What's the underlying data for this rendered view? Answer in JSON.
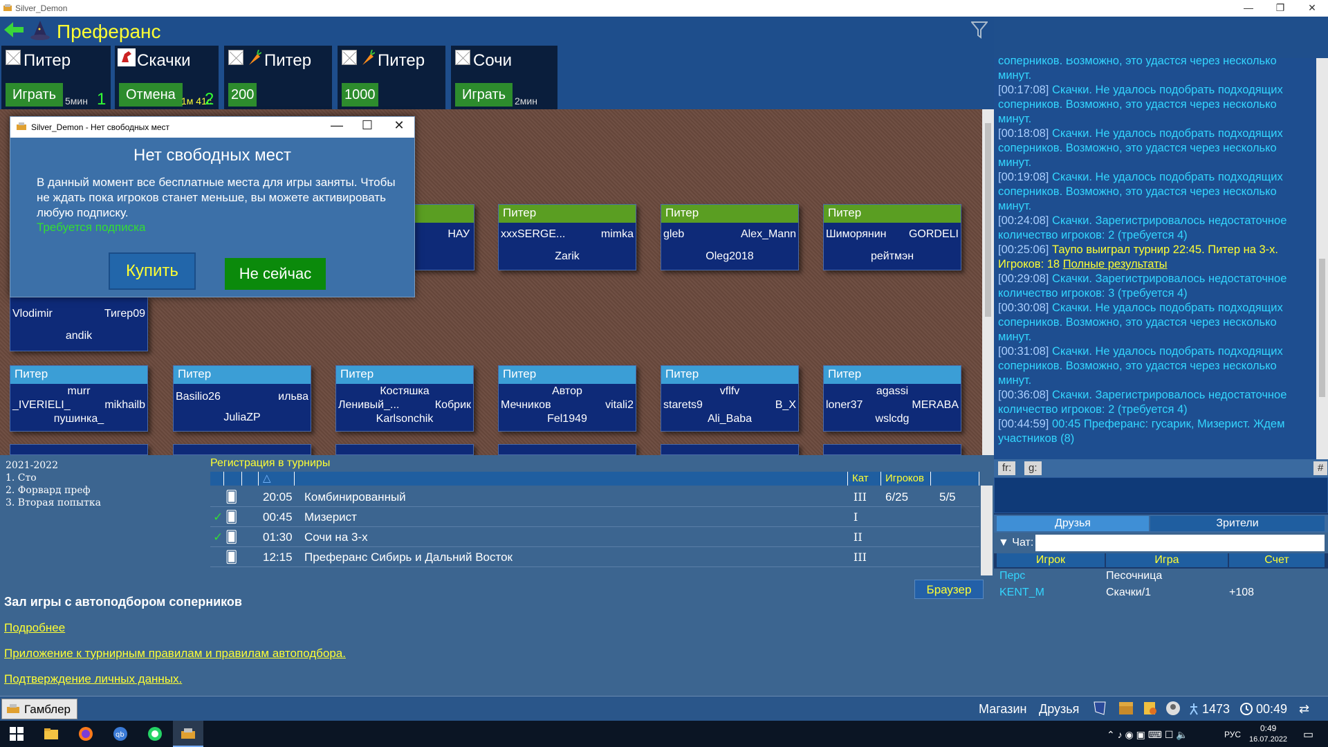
{
  "window": {
    "title": "Silver_Demon"
  },
  "header": {
    "title": "Преферанс"
  },
  "modes": [
    {
      "name": "Питер",
      "button": "Играть",
      "time": "5мин",
      "count": "1"
    },
    {
      "name": "Скачки",
      "button": "Отмена",
      "time": "1м 41с",
      "count": "2"
    },
    {
      "name": "Питер",
      "button": "200"
    },
    {
      "name": "Питер",
      "button": "1000"
    },
    {
      "name": "Сочи",
      "button": "Играть",
      "time": "2мин"
    }
  ],
  "tables": {
    "row1": [
      {
        "header": "Питер",
        "p1": "НАУ"
      },
      {
        "header": "Питер",
        "p1": "xxxSERGE...",
        "p2": "mimka",
        "p3": "Zarik"
      },
      {
        "header": "Питер",
        "p1": "gleb",
        "p2": "Alex_Mann",
        "p3": "Oleg2018"
      },
      {
        "header": "Питер",
        "p1": "Шиморянин",
        "p2": "GORDELI",
        "p3": "рейтмэн"
      }
    ],
    "row2": [
      {
        "p1": "Vlodimir",
        "p2": "Тигер09",
        "p3": "andik"
      }
    ],
    "row3": [
      {
        "header": "Питер",
        "p1": "murr",
        "p2": "_IVERIELI_",
        "p3": "mikhailb",
        "p4": "пушинка_"
      },
      {
        "header": "Питер",
        "p1": "Basilio26",
        "p2": "ильва",
        "p3": "JuliaZP"
      },
      {
        "header": "Питер",
        "p1": "Костяшка",
        "p2": "Ленивый_...",
        "p3": "Кобрик",
        "p4": "Karlsonchik"
      },
      {
        "header": "Питер",
        "p1": "Автор",
        "p2": "Мечников",
        "p3": "vitali2",
        "p4": "Fel1949"
      },
      {
        "header": "Питер",
        "p1": "vflfv",
        "p2": "starets9",
        "p3": "B_X",
        "p4": "Ali_Baba"
      },
      {
        "header": "Питер",
        "p1": "agassi",
        "p2": "loner37",
        "p3": "MERABA",
        "p4": "wslcdg"
      }
    ]
  },
  "dialog": {
    "title": "Silver_Demon - Нет свободных мест",
    "heading": "Нет свободных мест",
    "body": "В данный момент все бесплатные места для игры заняты. Чтобы не ждать пока игроков станет меньше, вы можете активировать любую подписку.",
    "requirement": "Требуется подписка",
    "buy": "Купить",
    "later": "Не сейчас"
  },
  "ratings": {
    "season": "2021-2022",
    "items": [
      "1. Сто",
      "2. Форвард преф",
      "3. Вторая попытка"
    ]
  },
  "registration": {
    "title": "Регистрация в турниры",
    "headers": {
      "cat": "Кат",
      "players": "Игроков"
    },
    "rows": [
      {
        "time": "20:05",
        "name": "Комбинированный",
        "cat": "III",
        "players": "6/25",
        "extra": "5/5",
        "check": ""
      },
      {
        "time": "00:45",
        "name": "Мизерист",
        "cat": "I",
        "players": "",
        "extra": "",
        "check": "✓"
      },
      {
        "time": "01:30",
        "name": "Сочи на 3-х",
        "cat": "II",
        "players": "",
        "extra": "",
        "check": "✓"
      },
      {
        "time": "12:15",
        "name": "Преферанс Сибирь и Дальний Восток",
        "cat": "III",
        "players": "",
        "extra": "",
        "check": ""
      }
    ],
    "browser": "Браузер"
  },
  "info": {
    "title": "Зал игры с автоподбором соперников",
    "links": [
      "Подробнее",
      "Приложение к турнирным правилам и правилам автоподбора.",
      "Подтверждение личных данных."
    ]
  },
  "chat": {
    "lines": [
      {
        "ts": "",
        "text": "соперников. Возможно, это удастся через несколько минут."
      },
      {
        "ts": "[00:17:08]",
        "text": "Скачки. Не удалось подобрать подходящих соперников. Возможно, это удастся через несколько минут."
      },
      {
        "ts": "[00:18:08]",
        "text": "Скачки. Не удалось подобрать подходящих соперников. Возможно, это удастся через несколько минут."
      },
      {
        "ts": "[00:19:08]",
        "text": "Скачки. Не удалось подобрать подходящих соперников. Возможно, это удастся через несколько минут."
      },
      {
        "ts": "[00:24:08]",
        "text": "Скачки. Зарегистрировалось недостаточное количество игроков: 2 (требуется 4)"
      }
    ],
    "announce": {
      "ts": "[00:25:06]",
      "text": "Таупо выиграл турнир 22:45. Питер на 3-х. Игроков: 18",
      "link": "Полные результаты"
    },
    "lines2": [
      {
        "ts": "[00:29:08]",
        "text": "Скачки. Зарегистрировалось недостаточное количество игроков: 3 (требуется 4)"
      },
      {
        "ts": "[00:30:08]",
        "text": "Скачки. Не удалось подобрать подходящих соперников. Возможно, это удастся через несколько минут."
      },
      {
        "ts": "[00:31:08]",
        "text": "Скачки. Не удалось подобрать подходящих соперников. Возможно, это удастся через несколько минут."
      },
      {
        "ts": "[00:36:08]",
        "text": "Скачки. Зарегистрировалось недостаточное количество игроков: 2 (требуется 4)"
      },
      {
        "ts": "[00:44:59]",
        "text": "00:45 Преферанс: гусарик, Мизерист. Ждем участников (8)"
      }
    ],
    "tabs": [
      "fr:",
      "g:",
      "#"
    ]
  },
  "friends": {
    "tabs": [
      "Друзья",
      "Зрители"
    ],
    "chat_label": "▼ Чат:",
    "headers": [
      "Игрок",
      "Игра",
      "Счет"
    ],
    "rows": [
      {
        "player": "Перс",
        "game": "Песочница",
        "score": ""
      },
      {
        "player": "KENT_M",
        "game": "Скачки/1",
        "score": "+108"
      }
    ]
  },
  "status": {
    "gambler": "Гамблер",
    "shop": "Магазин",
    "friends": "Друзья",
    "points": "1473",
    "time": "00:49"
  },
  "taskbar": {
    "lang": "РУС",
    "time": "0:49",
    "date": "16.07.2022"
  },
  "colors": {
    "accent": "#ffff33",
    "chat_text": "#33d6ff",
    "green": "#2d8c2d"
  }
}
